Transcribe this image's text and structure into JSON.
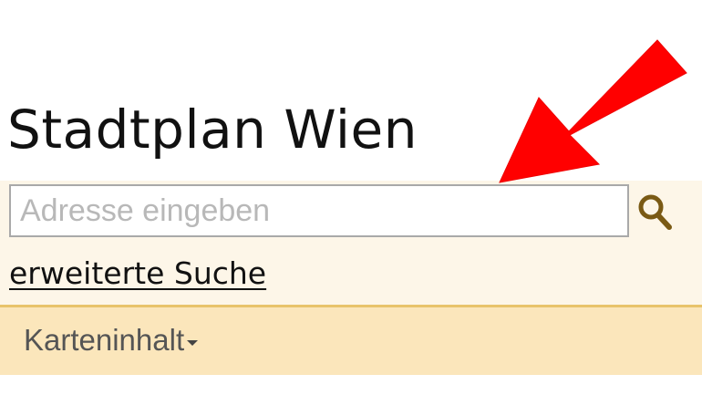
{
  "header": {
    "title": "Stadtplan Wien"
  },
  "search": {
    "placeholder": "Adresse eingeben",
    "value": "",
    "icon": "search-icon",
    "advanced_link_label": "erweiterte Suche"
  },
  "map_bar": {
    "map_content_label": "Karteninhalt",
    "map_content_icon": "caret-down-icon"
  },
  "annotation": {
    "icon": "arrow-icon",
    "color": "#ff0000"
  },
  "colors": {
    "panel_background": "#fdf6e8",
    "bar_background": "#fbe6bb",
    "divider": "#e8c36a",
    "search_icon": "#7a5a14"
  }
}
